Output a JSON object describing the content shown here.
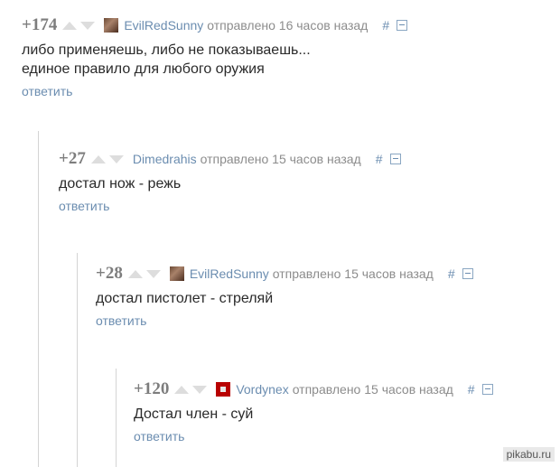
{
  "comments": [
    {
      "rating": "+174",
      "author": "EvilRedSunny",
      "meta": "отправлено 16 часов назад",
      "hash": "#",
      "lines": [
        "либо применяешь, либо не показываешь...",
        "единое правило для любого оружия"
      ],
      "reply": "ответить",
      "avatar_icon": "user-avatar-icon"
    },
    {
      "rating": "+27",
      "author": "Dimedrahis",
      "meta": "отправлено 15 часов назад",
      "hash": "#",
      "lines": [
        "достал нож - режь"
      ],
      "reply": "ответить",
      "avatar_icon": ""
    },
    {
      "rating": "+28",
      "author": "EvilRedSunny",
      "meta": "отправлено 15 часов назад",
      "hash": "#",
      "lines": [
        "достал пистолет - стреляй"
      ],
      "reply": "ответить",
      "avatar_icon": "user-avatar-icon"
    },
    {
      "rating": "+120",
      "author": "Vordynex",
      "meta": "отправлено 15 часов назад",
      "hash": "#",
      "lines": [
        "Достал член - суй"
      ],
      "reply": "ответить",
      "avatar_icon": "user-avatar-icon"
    }
  ],
  "watermark": "pikabu.ru",
  "colors": {
    "link": "#6b8db0",
    "rating": "#7d7d7d",
    "arrows": "#dddddd"
  }
}
